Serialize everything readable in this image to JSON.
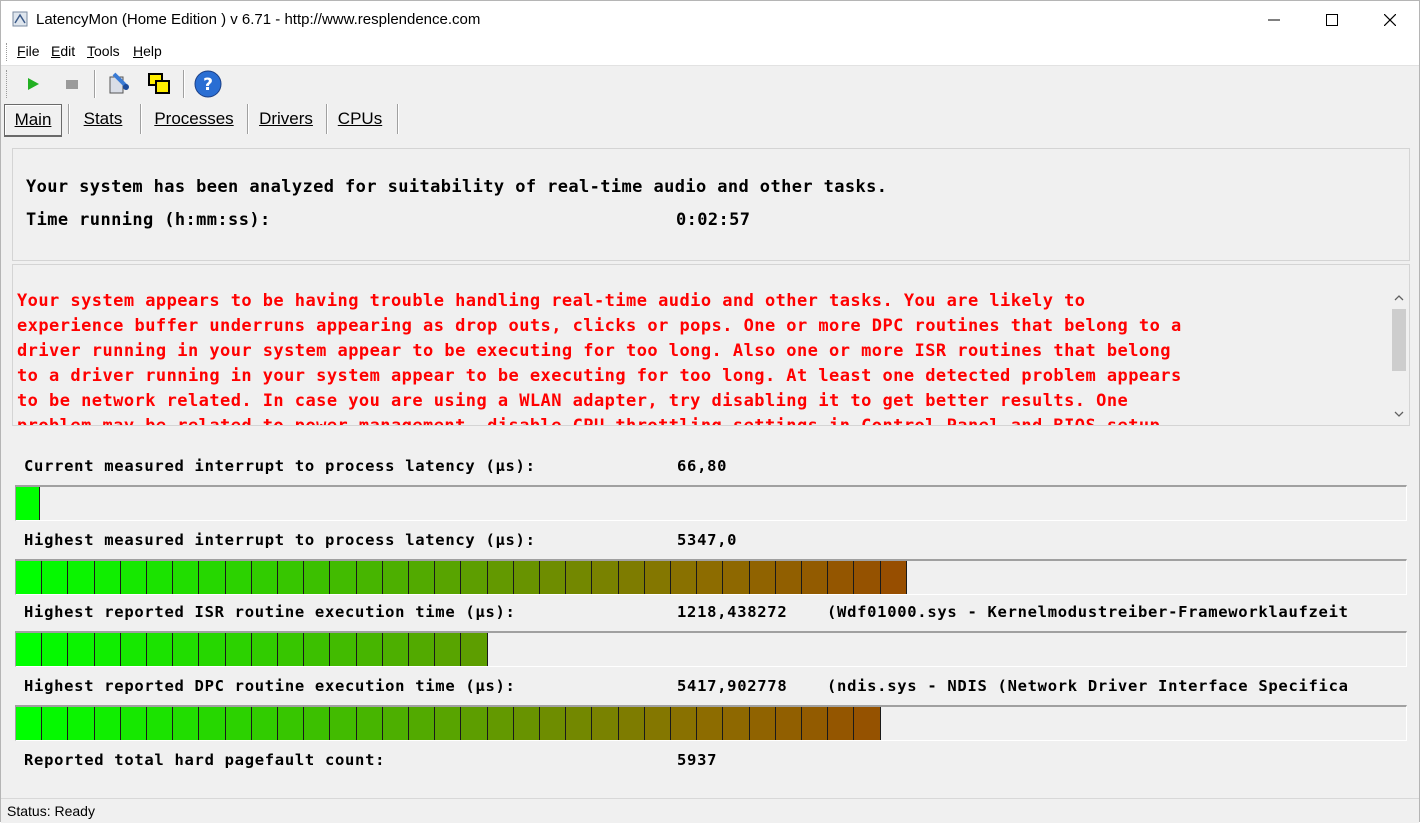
{
  "window": {
    "title": "LatencyMon  (Home Edition )  v 6.71 - http://www.resplendence.com"
  },
  "menu": [
    {
      "label": "File",
      "accel": "F",
      "rest": "ile"
    },
    {
      "label": "Edit",
      "accel": "E",
      "rest": "dit"
    },
    {
      "label": "Tools",
      "accel": "T",
      "rest": "ools"
    },
    {
      "label": "Help",
      "accel": "H",
      "rest": "elp"
    }
  ],
  "toolbar": {
    "icons": [
      "play-icon",
      "stop-icon",
      "analyzer-icon",
      "windows-icon",
      "help-icon"
    ]
  },
  "tabs": [
    {
      "label": "Main",
      "active": true
    },
    {
      "label": "Stats",
      "active": false
    },
    {
      "label": "Processes",
      "active": false
    },
    {
      "label": "Drivers",
      "active": false
    },
    {
      "label": "CPUs",
      "active": false
    }
  ],
  "summary": {
    "headline": "Your system has been analyzed for suitability of real-time audio and other tasks.",
    "time_label": "Time running (h:mm:ss):",
    "time_value": "0:02:57"
  },
  "warning": {
    "color": "#ff0000",
    "lines": [
      "Your system appears to be having trouble handling real-time audio and other tasks. You are likely to",
      "experience buffer underruns appearing as drop outs, clicks or pops. One or more DPC routines that belong to a",
      "driver running in your system appear to be executing for too long. Also one or more ISR routines that belong",
      "to a driver running in your system appear to be executing for too long. At least one detected problem appears",
      "to be network related. In case you are using a WLAN adapter, try disabling it to get better results. One",
      "problem may be related to power management, disable CPU throttling settings in Control Panel and BIOS setup."
    ]
  },
  "metrics": {
    "current_latency": {
      "label": "Current measured interrupt to process latency (µs):",
      "value": "66,80",
      "segments": 1
    },
    "highest_latency": {
      "label": "Highest measured interrupt to process latency (µs):",
      "value": "5347,0",
      "segments": 34
    },
    "isr": {
      "label": "Highest reported ISR routine execution time (µs):",
      "value": "1218,438272",
      "detail": "(Wdf01000.sys - Kernelmodustreiber-Frameworklaufzeit",
      "segments": 18
    },
    "dpc": {
      "label": "Highest reported DPC routine execution time (µs):",
      "value": "5417,902778",
      "detail": "(ndis.sys - NDIS (Network Driver Interface Specifica",
      "segments": 33
    },
    "pagefault": {
      "label": "Reported total hard pagefault count:",
      "value": "5937"
    }
  },
  "status": {
    "text": "Status: Ready"
  },
  "colors": {
    "meter_start": "#00ff00",
    "meter_end": "#b00000"
  }
}
